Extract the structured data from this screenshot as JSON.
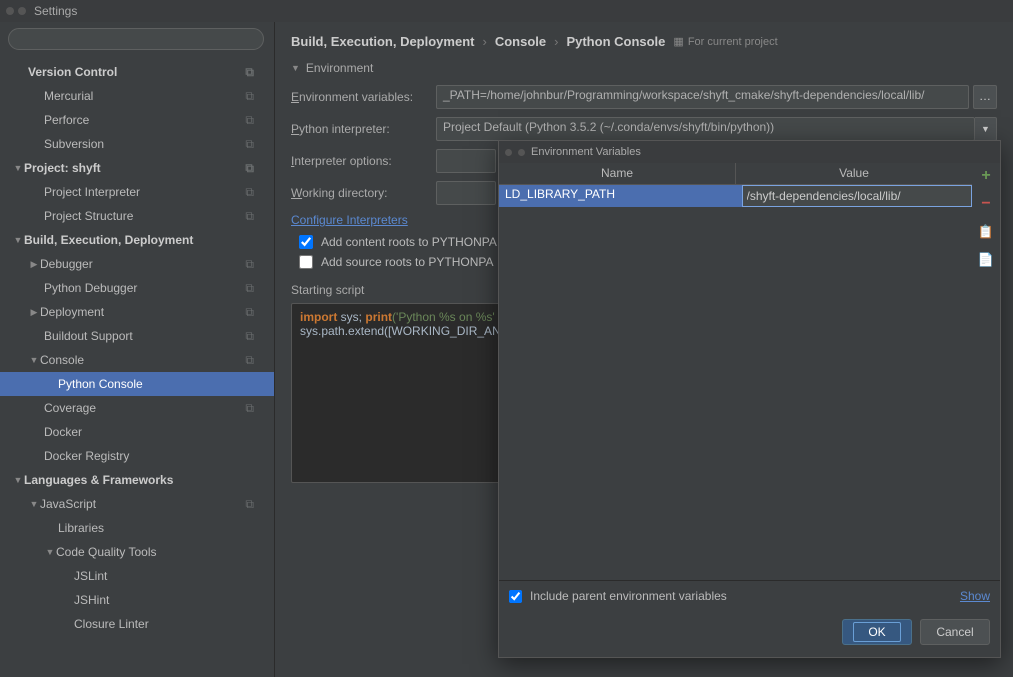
{
  "window_title": "Settings",
  "search_placeholder": "",
  "sidebar": {
    "items": [
      {
        "label": "Version Control",
        "bold": true,
        "caret": "",
        "indent": 28,
        "copy": true
      },
      {
        "label": "Mercurial",
        "indent": 44,
        "copy": true
      },
      {
        "label": "Perforce",
        "indent": 44,
        "copy": true
      },
      {
        "label": "Subversion",
        "indent": 44,
        "copy": true
      },
      {
        "label": "Project: shyft",
        "bold": true,
        "caret": "▼",
        "indent": 12,
        "copy": true
      },
      {
        "label": "Project Interpreter",
        "indent": 44,
        "copy": true
      },
      {
        "label": "Project Structure",
        "indent": 44,
        "copy": true
      },
      {
        "label": "Build, Execution, Deployment",
        "bold": true,
        "caret": "▼",
        "indent": 12
      },
      {
        "label": "Debugger",
        "caret": "▶",
        "indent": 28,
        "copy": true
      },
      {
        "label": "Python Debugger",
        "indent": 44,
        "copy": true
      },
      {
        "label": "Deployment",
        "caret": "▶",
        "indent": 28,
        "copy": true
      },
      {
        "label": "Buildout Support",
        "indent": 44,
        "copy": true
      },
      {
        "label": "Console",
        "caret": "▼",
        "indent": 28,
        "copy": true
      },
      {
        "label": "Python Console",
        "indent": 58,
        "selected": true
      },
      {
        "label": "Coverage",
        "indent": 44,
        "copy": true
      },
      {
        "label": "Docker",
        "indent": 44
      },
      {
        "label": "Docker Registry",
        "indent": 44
      },
      {
        "label": "Languages & Frameworks",
        "bold": true,
        "caret": "▼",
        "indent": 12
      },
      {
        "label": "JavaScript",
        "caret": "▼",
        "indent": 28,
        "copy": true
      },
      {
        "label": "Libraries",
        "indent": 58
      },
      {
        "label": "Code Quality Tools",
        "caret": "▼",
        "indent": 44
      },
      {
        "label": "JSLint",
        "indent": 74
      },
      {
        "label": "JSHint",
        "indent": 74
      },
      {
        "label": "Closure Linter",
        "indent": 74
      }
    ]
  },
  "breadcrumb": {
    "items": [
      "Build, Execution, Deployment",
      "Console",
      "Python Console"
    ],
    "project_badge": "For current project"
  },
  "env_section": "Environment",
  "form": {
    "env_var_label": "Environment variables:",
    "env_var_value": "_PATH=/home/johnbur/Programming/workspace/shyft_cmake/shyft-dependencies/local/lib/",
    "interpreter_label": "Python interpreter:",
    "interpreter_value": "Project Default (Python 3.5.2 (~/.conda/envs/shyft/bin/python))",
    "options_label": "Interpreter options:",
    "workdir_label": "Working directory:",
    "configure_link": "Configure Interpreters",
    "add_content": "Add content roots to PYTHONPA",
    "add_source": "Add source roots to PYTHONPA"
  },
  "starting_script_label": "Starting script",
  "script": {
    "line1_kw": "import",
    "line1_rest": " sys; ",
    "line1_kw2": "print",
    "line1_str": "('Python %s on %s'",
    "line2": "sys.path.extend([WORKING_DIR_AN"
  },
  "dialog": {
    "title": "Environment Variables",
    "col_name": "Name",
    "col_value": "Value",
    "rows": [
      {
        "name": "LD_LIBRARY_PATH",
        "value": "/shyft-dependencies/local/lib/"
      }
    ],
    "include_parent": "Include parent environment variables",
    "show_link": "Show",
    "ok": "OK",
    "cancel": "Cancel"
  }
}
